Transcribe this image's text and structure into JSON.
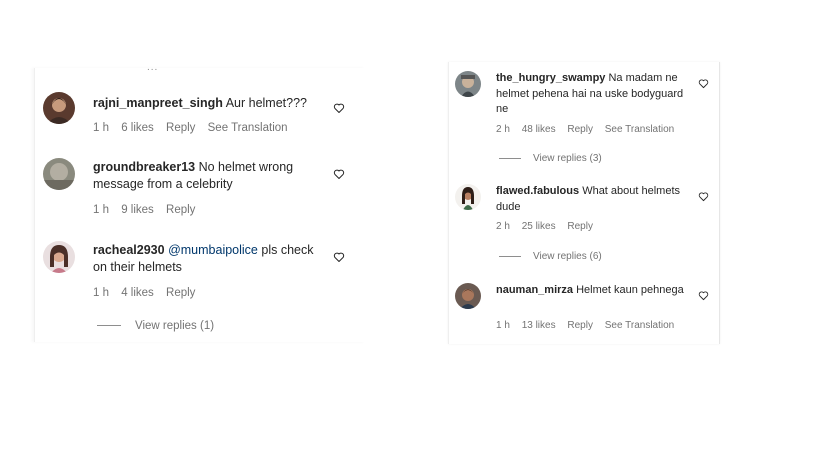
{
  "left": {
    "truncated": "...",
    "comments": [
      {
        "user": "rajni_manpreet_singh",
        "text": "Aur helmet???",
        "mention": "",
        "time": "1 h",
        "likes": "6 likes",
        "reply": "Reply",
        "translation": "See Translation"
      },
      {
        "user": "groundbreaker13",
        "text": "No helmet wrong message from a celebrity",
        "mention": "",
        "time": "1 h",
        "likes": "9 likes",
        "reply": "Reply",
        "translation": ""
      },
      {
        "user": "racheal2930",
        "mention": "@mumbaipolice",
        "text": "pls check on their helmets",
        "time": "1 h",
        "likes": "4 likes",
        "reply": "Reply",
        "translation": ""
      }
    ],
    "view_replies": "View replies (1)"
  },
  "right": {
    "comments": [
      {
        "user": "the_hungry_swampy",
        "text": "Na madam ne helmet pehena hai na uske bodyguard ne",
        "time": "2 h",
        "likes": "48 likes",
        "reply": "Reply",
        "translation": "See Translation",
        "view_replies": "View replies (3)"
      },
      {
        "user": "flawed.fabulous",
        "text": "What about helmets dude",
        "time": "2 h",
        "likes": "25 likes",
        "reply": "Reply",
        "translation": "",
        "view_replies": "View replies (6)"
      },
      {
        "user": "nauman_mirza",
        "text": "Helmet kaun pehnega",
        "time": "1 h",
        "likes": "13 likes",
        "reply": "Reply",
        "translation": "See Translation",
        "view_replies": ""
      }
    ]
  },
  "icons": {
    "like": "heart-outline-icon",
    "avatar": "profile-avatar"
  },
  "colors": {
    "text": "#262626",
    "meta": "#737373",
    "mention": "#00376b"
  }
}
